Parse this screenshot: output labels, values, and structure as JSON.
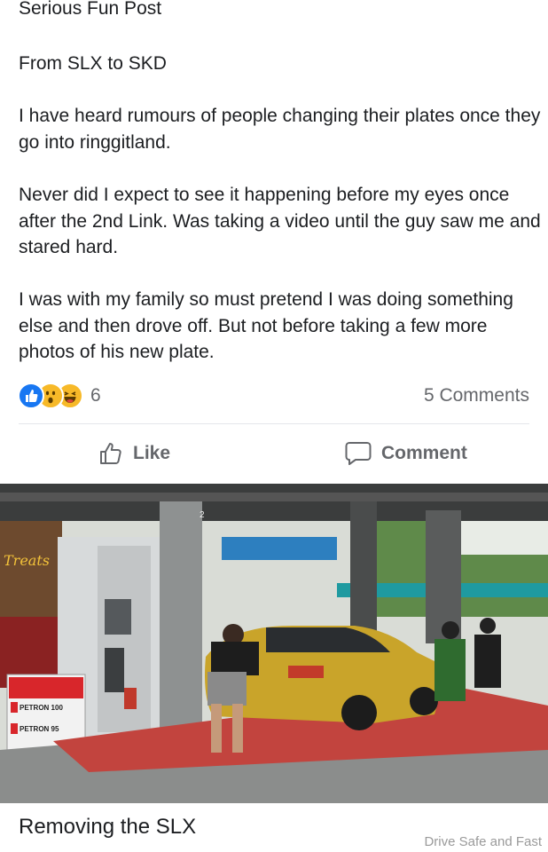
{
  "post": {
    "group_name": "Serious Fun Post",
    "paragraphs": [
      "From SLX to SKD",
      "I have heard rumours of people changing their plates once they go into ringgitland.",
      "Never did I expect to see it happening before my eyes once after the 2nd Link. Was taking a video until the guy saw me and stared hard.",
      "I was with my family so must pretend I was doing something else and then drove off. But not before taking a few more photos of his new plate."
    ],
    "reactions": {
      "icons": [
        "like-icon",
        "wow-icon",
        "haha-icon"
      ],
      "count": "6"
    },
    "comments_label": "5 Comments",
    "actions": {
      "like_label": "Like",
      "comment_label": "Comment"
    }
  },
  "photo": {
    "signs": {
      "treats": "Treats",
      "petron_100": "PETRON 100",
      "petron_95": "PETRON 95",
      "pump_number": "2"
    },
    "colors": {
      "car": "#c9a42a",
      "petron_red": "#d8262b",
      "forecourt": "#c2443e",
      "canopy_teal": "#1f9aa0"
    }
  },
  "caption": "Removing the SLX",
  "watermark": "Drive Safe and Fast"
}
